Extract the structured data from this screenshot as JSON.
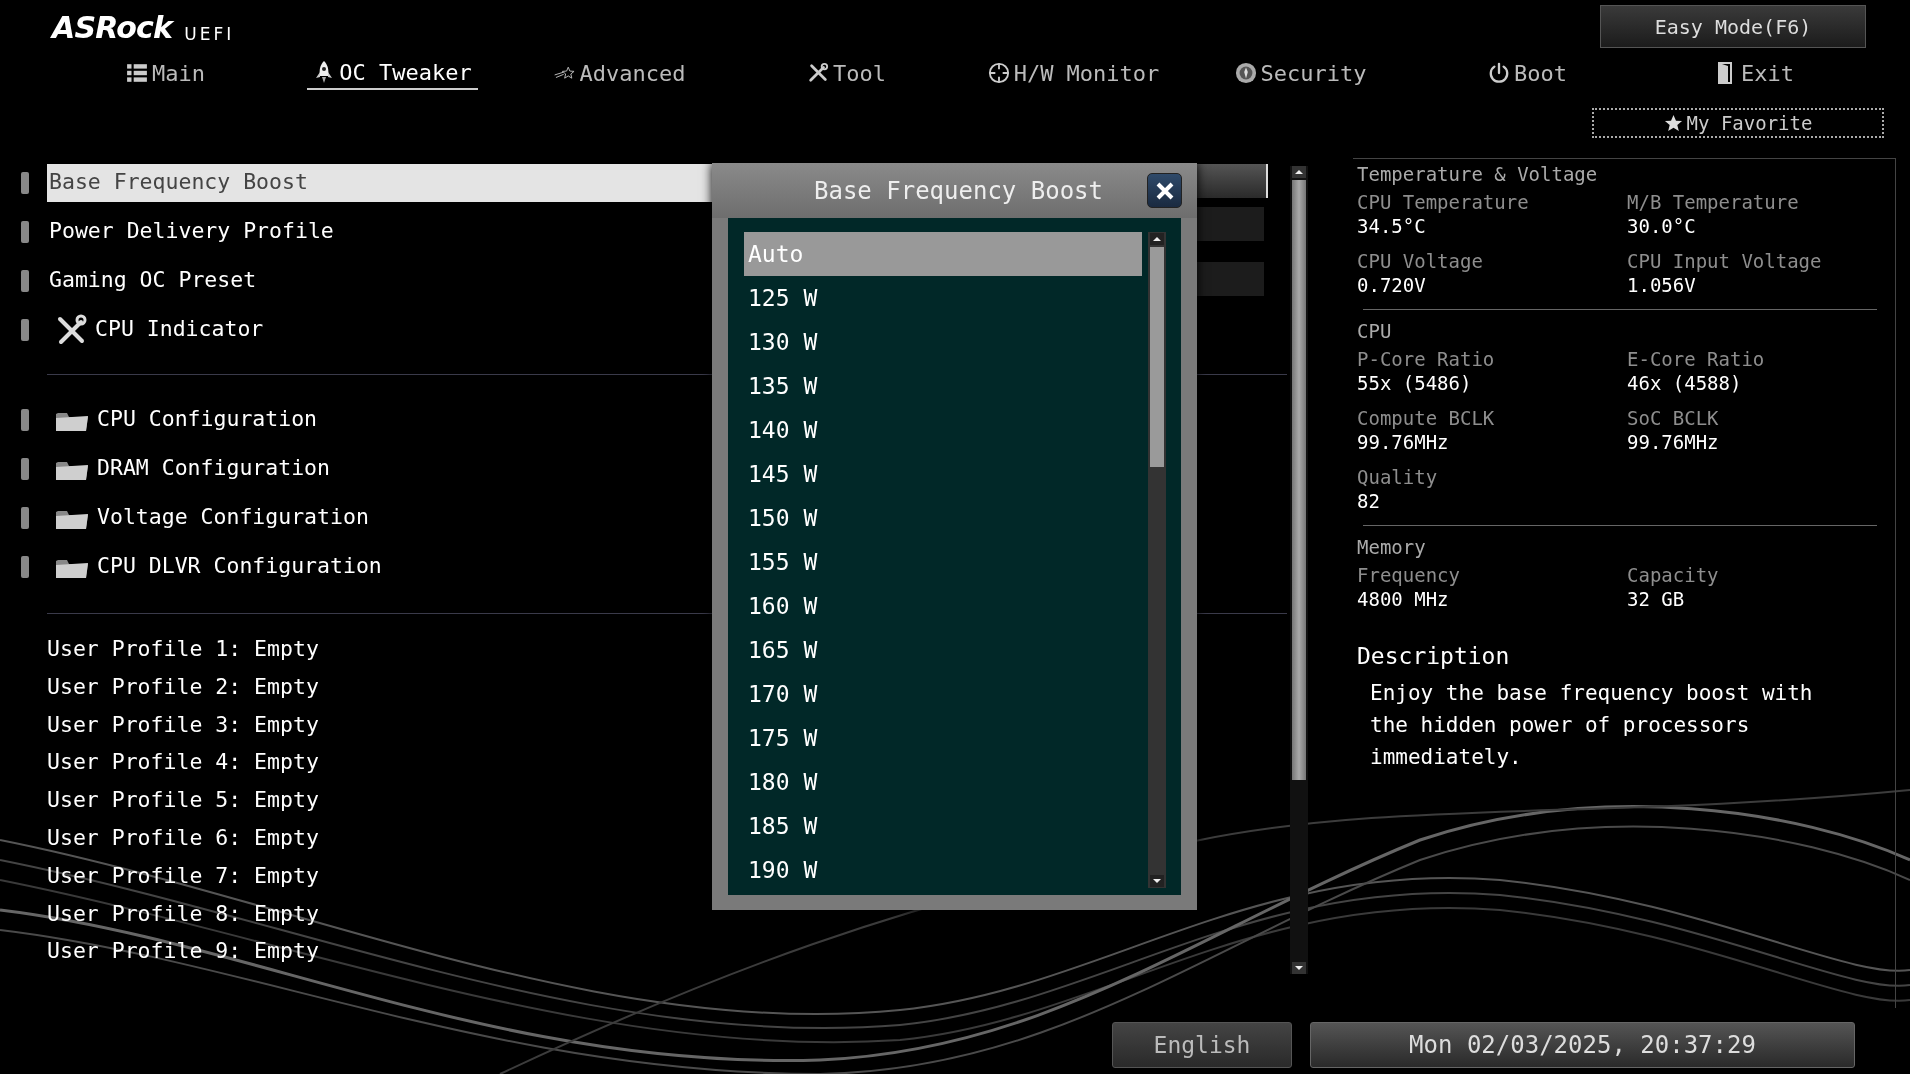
{
  "header": {
    "logo": "ASRock",
    "logo_suffix": "UEFI",
    "easy_mode_button": "Easy Mode(F6)",
    "my_favorite_button": "My Favorite"
  },
  "tabs": [
    {
      "label": "Main",
      "selected": false
    },
    {
      "label": "OC Tweaker",
      "selected": true
    },
    {
      "label": "Advanced",
      "selected": false
    },
    {
      "label": "Tool",
      "selected": false
    },
    {
      "label": "H/W Monitor",
      "selected": false
    },
    {
      "label": "Security",
      "selected": false
    },
    {
      "label": "Boot",
      "selected": false
    },
    {
      "label": "Exit",
      "selected": false
    }
  ],
  "settings": [
    {
      "label": "Base Frequency Boost",
      "kind": "setting",
      "selected": true
    },
    {
      "label": "Power Delivery Profile",
      "kind": "setting",
      "selected": false
    },
    {
      "label": "Gaming OC Preset",
      "kind": "setting",
      "selected": false
    },
    {
      "label": "CPU Indicator",
      "kind": "tool",
      "selected": false
    },
    {
      "kind": "divider"
    },
    {
      "label": "CPU Configuration",
      "kind": "folder",
      "selected": false
    },
    {
      "label": "DRAM Configuration",
      "kind": "folder",
      "selected": false
    },
    {
      "label": "Voltage Configuration",
      "kind": "folder",
      "selected": false
    },
    {
      "label": "CPU DLVR Configuration",
      "kind": "folder",
      "selected": false
    }
  ],
  "user_profiles": [
    "User Profile 1: Empty",
    "User Profile 2: Empty",
    "User Profile 3: Empty",
    "User Profile 4: Empty",
    "User Profile 5: Empty",
    "User Profile 6: Empty",
    "User Profile 7: Empty",
    "User Profile 8: Empty",
    "User Profile 9: Empty"
  ],
  "popup": {
    "title": "Base Frequency Boost",
    "options": [
      {
        "label": "Auto",
        "selected": true
      },
      {
        "label": "125 W",
        "selected": false
      },
      {
        "label": "130 W",
        "selected": false
      },
      {
        "label": "135 W",
        "selected": false
      },
      {
        "label": "140 W",
        "selected": false
      },
      {
        "label": "145 W",
        "selected": false
      },
      {
        "label": "150 W",
        "selected": false
      },
      {
        "label": "155 W",
        "selected": false
      },
      {
        "label": "160 W",
        "selected": false
      },
      {
        "label": "165 W",
        "selected": false
      },
      {
        "label": "170 W",
        "selected": false
      },
      {
        "label": "175 W",
        "selected": false
      },
      {
        "label": "180 W",
        "selected": false
      },
      {
        "label": "185 W",
        "selected": false
      },
      {
        "label": "190 W",
        "selected": false
      }
    ]
  },
  "info_panel": [
    {
      "title": "Temperature & Voltage",
      "items": [
        {
          "label": "CPU Temperature",
          "value": "34.5°C"
        },
        {
          "label": "M/B Temperature",
          "value": "30.0°C"
        },
        {
          "label": "CPU Voltage",
          "value": "0.720V"
        },
        {
          "label": "CPU Input Voltage",
          "value": "1.056V"
        }
      ]
    },
    {
      "title": "CPU",
      "items": [
        {
          "label": "P-Core Ratio",
          "value": "55x (5486)"
        },
        {
          "label": "E-Core Ratio",
          "value": "46x (4588)"
        },
        {
          "label": "Compute BCLK",
          "value": "99.76MHz"
        },
        {
          "label": "SoC BCLK",
          "value": "99.76MHz"
        },
        {
          "label": "Quality",
          "value": "82"
        }
      ]
    },
    {
      "title": "Memory",
      "items": [
        {
          "label": "Frequency",
          "value": "4800 MHz"
        },
        {
          "label": "Capacity",
          "value": "32 GB"
        }
      ]
    }
  ],
  "description": {
    "title": "Description",
    "text": "Enjoy the base frequency boost with the hidden power of processors immediately."
  },
  "footer": {
    "language": "English",
    "datetime": "Mon 02/03/2025, 20:37:29"
  }
}
